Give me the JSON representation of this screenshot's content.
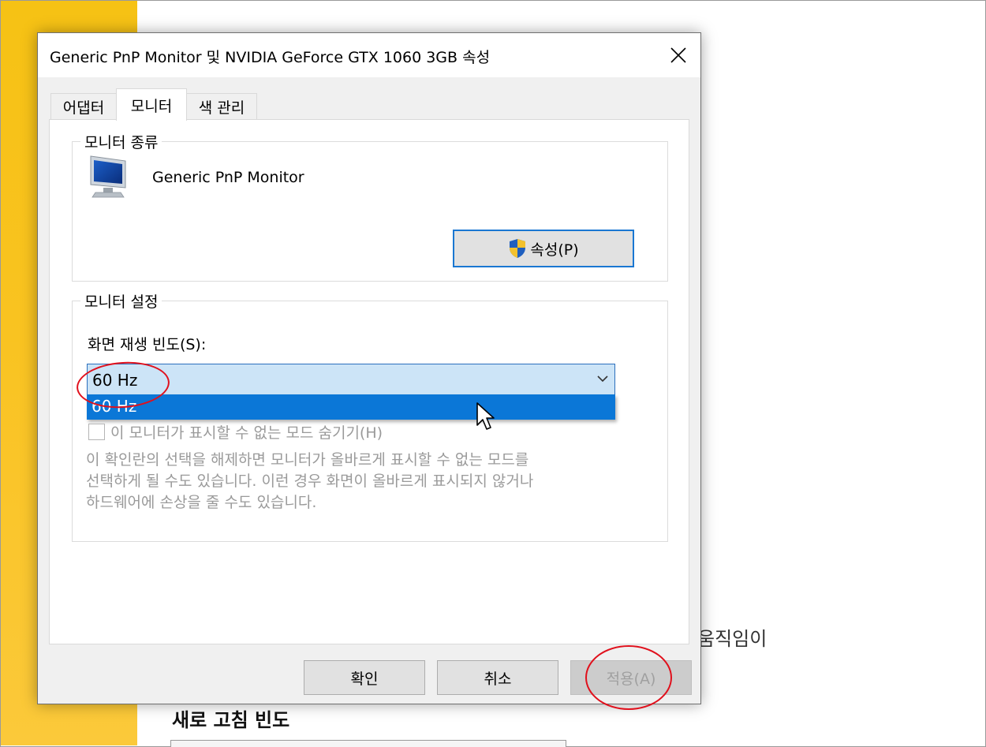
{
  "background": {
    "motion_text": "움직임이",
    "refresh_heading": "새로 고침 빈도"
  },
  "dialog": {
    "title": "Generic PnP Monitor 및 NVIDIA GeForce GTX 1060 3GB 속성",
    "tabs": [
      {
        "label": "어댑터",
        "active": false
      },
      {
        "label": "모니터",
        "active": true
      },
      {
        "label": "색 관리",
        "active": false
      }
    ],
    "monitor_type": {
      "group_label": "모니터 종류",
      "monitor_name": "Generic PnP Monitor",
      "properties_button": "속성(P)",
      "monitor_icon": "monitor-icon",
      "shield_icon": "uac-shield-icon"
    },
    "monitor_settings": {
      "group_label": "모니터 설정",
      "refresh_rate_label": "화면 재생 빈도(S):",
      "refresh_rate_selected": "60 Hz",
      "dropdown_options": [
        "60 Hz"
      ],
      "hide_modes_checkbox_label": "이 모니터가 표시할 수 없는 모드 숨기기(H)",
      "hide_modes_checked": false,
      "warning_lines": [
        "이 확인란의 선택을 해제하면 모니터가 올바르게 표시할 수 없는 모드를",
        "선택하게 될 수도 있습니다. 이런 경우 화면이 올바르게 표시되지 않거나",
        "하드웨어에 손상을 줄 수도 있습니다."
      ]
    },
    "buttons": {
      "ok": "확인",
      "cancel": "취소",
      "apply": "적용(A)"
    }
  },
  "colors": {
    "accent_blue": "#0b77d7",
    "highlight_red": "#e0101c",
    "desktop_yellow": "#f9c321"
  }
}
